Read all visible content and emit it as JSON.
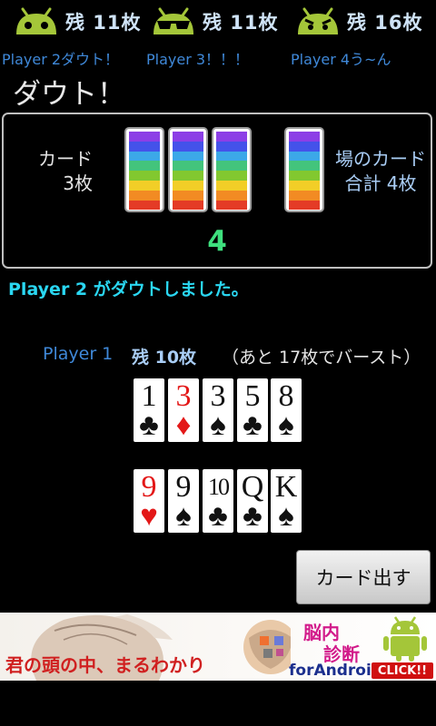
{
  "opponents": [
    {
      "count_label": "残 11枚",
      "message": "Player 2ダウト！"
    },
    {
      "count_label": "残 11枚",
      "message": "Player 3！！！"
    },
    {
      "count_label": "残 16枚",
      "message": "Player 4う~ん"
    }
  ],
  "title": "ダウト！",
  "panel": {
    "left_label_1": "カード",
    "left_label_2": "3枚",
    "right_label_1": "場のカード",
    "right_label_2": "合計 4枚",
    "center_number": "4"
  },
  "status_message": "Player 2 がダウトしました。",
  "player": {
    "name": "Player 1",
    "remaining": "残 10枚",
    "burst": "（あと 17枚でバースト）"
  },
  "hand_row_1": [
    {
      "rank": "1",
      "suit": "♣",
      "color": "black"
    },
    {
      "rank": "3",
      "suit": "♦",
      "color": "red"
    },
    {
      "rank": "3",
      "suit": "♠",
      "color": "black"
    },
    {
      "rank": "5",
      "suit": "♣",
      "color": "black"
    },
    {
      "rank": "8",
      "suit": "♠",
      "color": "black"
    }
  ],
  "hand_row_2": [
    {
      "rank": "9",
      "suit": "♥",
      "color": "red"
    },
    {
      "rank": "9",
      "suit": "♠",
      "color": "black"
    },
    {
      "rank": "10",
      "suit": "♣",
      "color": "black"
    },
    {
      "rank": "Q",
      "suit": "♣",
      "color": "black"
    },
    {
      "rank": "K",
      "suit": "♠",
      "color": "black"
    }
  ],
  "play_button": "カード出す",
  "ad": {
    "headline": "君の頭の中、まるわかり",
    "title_1": "脳内",
    "title_2": "診断",
    "platform": "forAndroid",
    "cta": "CLICK!!"
  },
  "colors": {
    "accent_blue": "#3f88d8",
    "number_green": "#3ee07e",
    "status_cyan": "#2ad7f2",
    "android_green": "#a4c639"
  }
}
